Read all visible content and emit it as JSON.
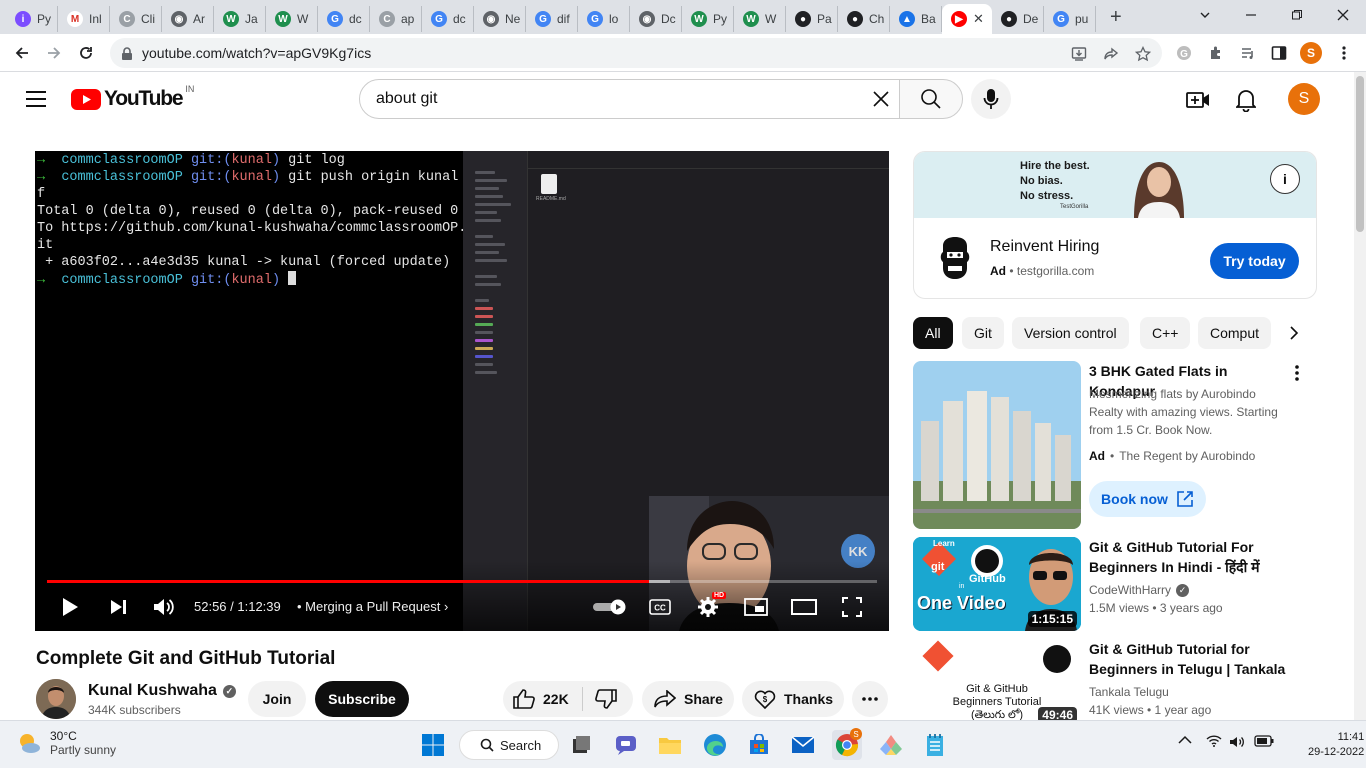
{
  "browser": {
    "tabs": [
      {
        "label": "Py",
        "fav": "#7c4dff",
        "glyph": "i"
      },
      {
        "label": "Inl",
        "fav": "#ffffff",
        "glyph": "M"
      },
      {
        "label": "Cli",
        "fav": "#9aa0a6",
        "glyph": "C"
      },
      {
        "label": "Ar",
        "fav": "#5f6368",
        "glyph": "◉"
      },
      {
        "label": "Ja",
        "fav": "#1f8f4e",
        "glyph": "W"
      },
      {
        "label": "W",
        "fav": "#1f8f4e",
        "glyph": "W"
      },
      {
        "label": "dc",
        "fav": "#4285f4",
        "glyph": "G"
      },
      {
        "label": "ap",
        "fav": "#9aa0a6",
        "glyph": "C"
      },
      {
        "label": "dc",
        "fav": "#4285f4",
        "glyph": "G"
      },
      {
        "label": "Ne",
        "fav": "#5f6368",
        "glyph": "◉"
      },
      {
        "label": "dif",
        "fav": "#4285f4",
        "glyph": "G"
      },
      {
        "label": "lo",
        "fav": "#4285f4",
        "glyph": "G"
      },
      {
        "label": "Dc",
        "fav": "#5f6368",
        "glyph": "◉"
      },
      {
        "label": "Py",
        "fav": "#1f8f4e",
        "glyph": "W"
      },
      {
        "label": "W",
        "fav": "#1f8f4e",
        "glyph": "W"
      },
      {
        "label": "Pa",
        "fav": "#202124",
        "glyph": "●"
      },
      {
        "label": "Ch",
        "fav": "#202124",
        "glyph": "●"
      },
      {
        "label": "Ba",
        "fav": "#1a73e8",
        "glyph": "▲"
      },
      {
        "label": "",
        "fav": "#ff0000",
        "glyph": "▶",
        "active": true
      },
      {
        "label": "De",
        "fav": "#202124",
        "glyph": "●"
      },
      {
        "label": "pu",
        "fav": "#4285f4",
        "glyph": "G"
      }
    ],
    "close_tab_glyph": "✕",
    "new_tab_glyph": "+",
    "url": "youtube.com/watch?v=apGV9Kg7ics",
    "profile_initial": "S"
  },
  "youtube": {
    "logo_text": "YouTube",
    "country_code": "IN",
    "search_query": "about git",
    "avatar_initial": "S"
  },
  "player": {
    "terminal_lines": [
      [
        "→  ",
        "commclassroomOP ",
        "git:(",
        "kunal",
        ") ",
        "git log"
      ],
      [
        "→  ",
        "commclassroomOP ",
        "git:(",
        "kunal",
        ") ",
        "git push origin kunal -"
      ],
      [
        "",
        "f"
      ],
      [
        "",
        "Total 0 (delta 0), reused 0 (delta 0), pack-reused 0"
      ],
      [
        "",
        "To https://github.com/kunal-kushwaha/commclassroomOP.g"
      ],
      [
        "",
        "it"
      ],
      [
        "",
        " + a603f02...a4e3d35 kunal -> kunal (forced update)"
      ],
      [
        "→  ",
        "commclassroomOP ",
        "git:(",
        "kunal",
        ") "
      ]
    ],
    "finder_file": "README.md",
    "watermark": "KK",
    "progress": 0.725,
    "buffered": 0.75,
    "time": "52:56 / 1:12:39",
    "chapter": "Merging a Pull Request",
    "hd_badge": "HD"
  },
  "video": {
    "title": "Complete Git and GitHub Tutorial",
    "channel": "Kunal Kushwaha",
    "subscribers": "344K subscribers",
    "join": "Join",
    "subscribe": "Subscribe",
    "likes": "22K",
    "share": "Share",
    "thanks": "Thanks"
  },
  "ad": {
    "banner_lines": [
      "Hire the best.",
      "No bias.",
      "No stress."
    ],
    "banner_brand": "TestGorilla",
    "title": "Reinvent Hiring",
    "ad_label": "Ad",
    "domain": "testgorilla.com",
    "cta": "Try today"
  },
  "chips": [
    "All",
    "Git",
    "Version control",
    "C++",
    "Comput"
  ],
  "related": [
    {
      "title": "3 BHK Gated Flats in Kondapur",
      "description": "Mesmerizing flats by Aurobindo Realty with amazing views. Starting from 1.5 Cr. Book Now.",
      "ad_label": "Ad",
      "advertiser": "The Regent by Aurobindo",
      "cta": "Book now"
    },
    {
      "title": "Git & GitHub Tutorial For Beginners In Hindi - हिंदी में",
      "channel": "CodeWithHarry",
      "meta": "1.5M views • 3 years ago",
      "duration": "1:15:15",
      "thumb_text": "One Video",
      "thumb_small": [
        "Learn",
        "git",
        "GitHub",
        "in"
      ]
    },
    {
      "title": "Git & GitHub Tutorial for Beginners in Telugu | Tankala",
      "channel": "Tankala Telugu",
      "meta": "41K views • 1 year ago",
      "duration": "49:46",
      "thumb_lines": [
        "Git & GitHub",
        "Beginners Tutorial",
        "(తెలుగు లో)"
      ]
    }
  ],
  "taskbar": {
    "temp": "30°C",
    "weather": "Partly sunny",
    "search": "Search",
    "time": "11:41",
    "date": "29-12-2022"
  }
}
